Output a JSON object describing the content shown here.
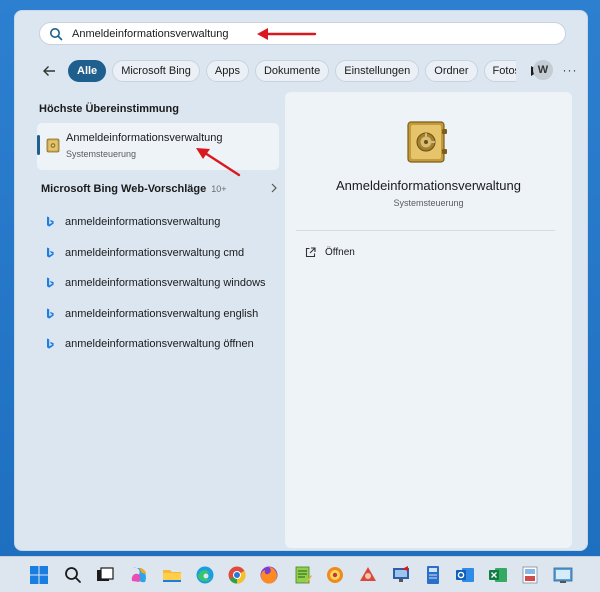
{
  "search": {
    "query": "Anmeldeinformationsverwaltung"
  },
  "filters": {
    "items": [
      "Alle",
      "Microsoft Bing",
      "Apps",
      "Dokumente",
      "Einstellungen",
      "Ordner",
      "Fotos"
    ],
    "active": "Alle",
    "avatar_letter": "W",
    "more": "···"
  },
  "best_match": {
    "heading": "Höchste Übereinstimmung",
    "title": "Anmeldeinformationsverwaltung",
    "subtitle": "Systemsteuerung"
  },
  "bing": {
    "heading": "Microsoft Bing Web-Vorschläge",
    "count": "10+",
    "suggestions": [
      "anmeldeinformationsverwaltung",
      "anmeldeinformationsverwaltung cmd",
      "anmeldeinformationsverwaltung windows",
      "anmeldeinformationsverwaltung english",
      "anmeldeinformationsverwaltung öffnen"
    ]
  },
  "detail": {
    "title": "Anmeldeinformationsverwaltung",
    "subtitle": "Systemsteuerung",
    "open_label": "Öffnen"
  },
  "colors": {
    "accent": "#1e5f8e",
    "annotation_arrow": "#d9191f",
    "panel_bg": "#dbe6f1",
    "desktop": "#1e6fc0"
  },
  "taskbar": {
    "icons": [
      "start-icon",
      "search-icon",
      "task-view-icon",
      "copilot-icon",
      "file-explorer-icon",
      "edge-icon",
      "chrome-icon",
      "firefox-icon",
      "notepad-icon",
      "app-icon",
      "app-icon",
      "app-icon",
      "app-icon",
      "outlook-icon",
      "excel-icon",
      "app-icon",
      "app-icon"
    ]
  }
}
